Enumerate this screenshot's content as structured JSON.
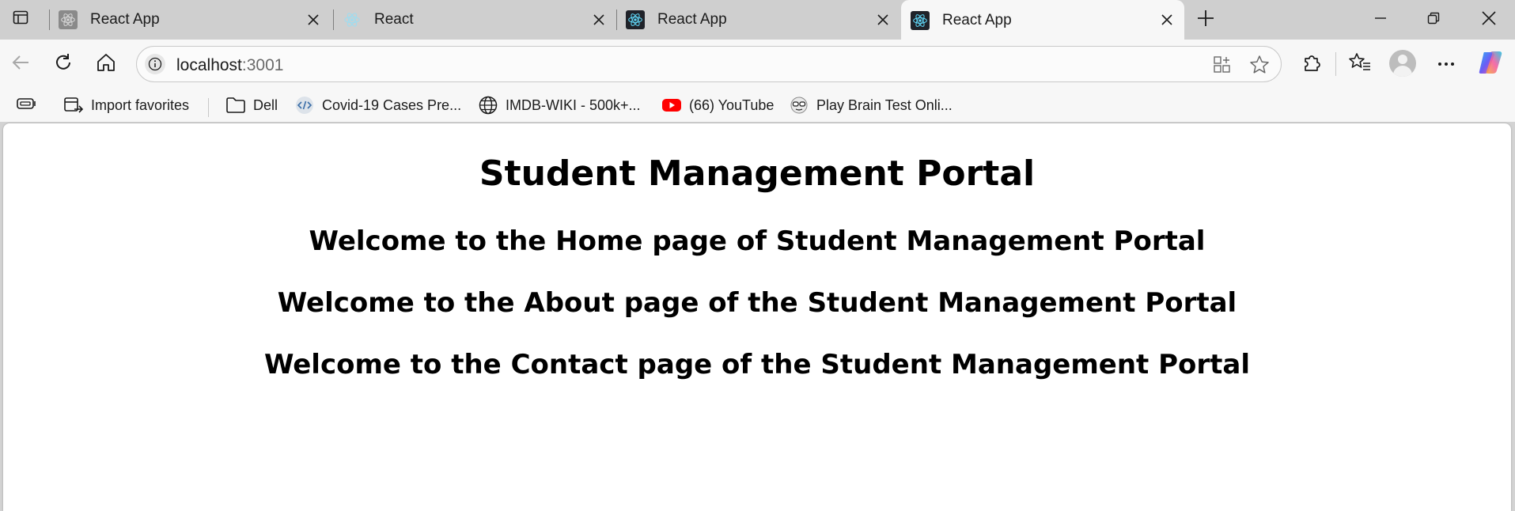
{
  "tabs": [
    {
      "title": "React App",
      "favicon": "react-logo-icon",
      "active": false
    },
    {
      "title": "React",
      "favicon": "react-logo-icon",
      "active": false
    },
    {
      "title": "React App",
      "favicon": "react-logo-icon",
      "active": false
    },
    {
      "title": "React App",
      "favicon": "react-logo-icon",
      "active": true
    }
  ],
  "address": {
    "host": "localhost",
    "port": ":3001"
  },
  "favorites": [
    {
      "label": "Import favorites",
      "icon": "import-favorites-icon"
    },
    {
      "label": "Dell",
      "icon": "folder-icon"
    },
    {
      "label": "Covid-19 Cases Pre...",
      "icon": "code-icon"
    },
    {
      "label": "IMDB-WIKI - 500k+...",
      "icon": "globe-icon"
    },
    {
      "label": "(66) YouTube",
      "icon": "youtube-icon"
    },
    {
      "label": "Play Brain Test Onli...",
      "icon": "brain-test-icon"
    }
  ],
  "content": {
    "title": "Student Management Portal",
    "home": "Welcome to the Home page of Student Management Portal",
    "about": "Welcome to the About page of the Student Management Portal",
    "contact": "Welcome to the Contact page of the Student Management Portal"
  },
  "colors": {
    "react": "#61dafb",
    "youtube": "#ff0000",
    "copilot": "#8a5cf6"
  }
}
